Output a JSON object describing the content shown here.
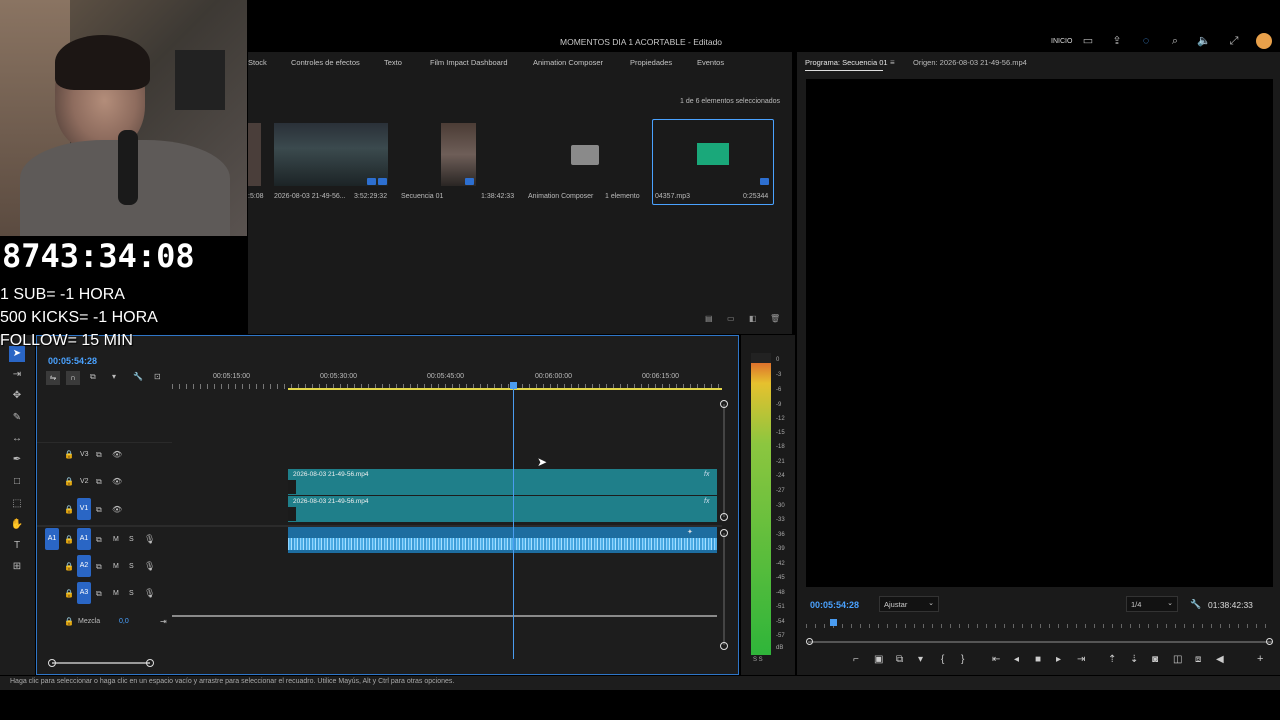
{
  "window": {
    "title": "MOMENTOS DIA 1 ACORTABLE - Editado",
    "workspace": "INICIO"
  },
  "overlay": {
    "countdown": "8743:34:08",
    "rules": [
      "1 SUB= -1 HORA",
      "500 KICKS= -1 HORA",
      "FOLLOW= 15 MIN"
    ]
  },
  "project": {
    "tabs": [
      "Stock",
      "Controles de efectos",
      "Texto",
      "Film Impact Dashboard",
      "Animation Composer",
      "Propiedades",
      "Eventos"
    ],
    "selection_status": "1 de 6 elementos seleccionados",
    "items": [
      {
        "label": ":5:08",
        "value": ""
      },
      {
        "label": "2026-08-03 21-49-56...",
        "value": "3:52:29:32"
      },
      {
        "label": "Secuencia 01",
        "value": "1:38:42:33"
      },
      {
        "label": "Animation Composer",
        "value": "1 elemento"
      },
      {
        "label": "04357.mp3",
        "value": "0:25344"
      }
    ]
  },
  "program": {
    "tab": "Programa: Secuencia 01",
    "origin_tab": "Origen: 2026-08-03 21-49-56.mp4",
    "timecode": "00:05:54:28",
    "fit": "Ajustar",
    "quality": "1/4",
    "duration": "01:38:42:33"
  },
  "timeline": {
    "timecode": "00:05:54:28",
    "ruler": [
      "00:05:15:00",
      "00:05:30:00",
      "00:05:45:00",
      "00:06:00:00",
      "00:06:15:00"
    ],
    "tracks": {
      "v3": "V3",
      "v2": "V2",
      "v1": "V1",
      "a1_source": "A1",
      "a1": "A1",
      "a2": "A2",
      "a3": "A3",
      "m": "M",
      "s": "S"
    },
    "clips": {
      "v2": "2026-08-03 21-49-56.mp4",
      "v1": "2026-08-03 21-49-56.mp4",
      "fx": "fx"
    },
    "mix_label": "Mezcla",
    "mix_value": "0,0"
  },
  "meters": {
    "scale": [
      "0",
      "-3",
      "-6",
      "-9",
      "-12",
      "-15",
      "-18",
      "-21",
      "-24",
      "-27",
      "-30",
      "-33",
      "-36",
      "-39",
      "-42",
      "-45",
      "-48",
      "-51",
      "-54",
      "-57",
      "dB"
    ],
    "solo": "S S"
  },
  "status": {
    "text": "Haga clic para seleccionar o haga clic en un espacio vacío y arrastre para seleccionar el recuadro. Utilice Mayús, Alt y Ctrl para otras opciones."
  }
}
